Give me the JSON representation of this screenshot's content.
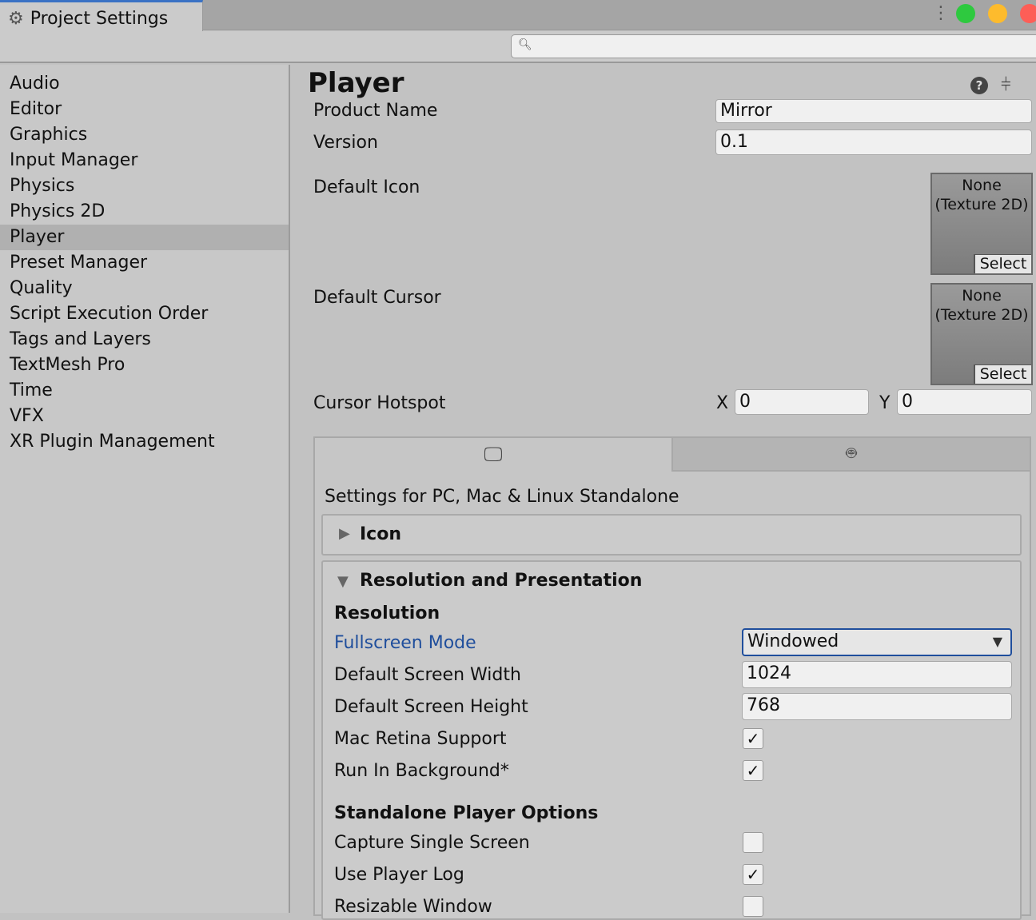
{
  "window": {
    "tab_title": "Project Settings",
    "search_placeholder": ""
  },
  "sidebar": {
    "items": [
      "Audio",
      "Editor",
      "Graphics",
      "Input Manager",
      "Physics",
      "Physics 2D",
      "Player",
      "Preset Manager",
      "Quality",
      "Script Execution Order",
      "Tags and Layers",
      "TextMesh Pro",
      "Time",
      "VFX",
      "XR Plugin Management"
    ],
    "selected": "Player"
  },
  "main": {
    "title": "Player",
    "product_name_label": "Product Name",
    "product_name": "Mirror",
    "version_label": "Version",
    "version": "0.1",
    "default_icon_label": "Default Icon",
    "default_cursor_label": "Default Cursor",
    "object_none": "None",
    "object_type": "(Texture 2D)",
    "select_label": "Select",
    "cursor_hotspot_label": "Cursor Hotspot",
    "x_label": "X",
    "x": "0",
    "y_label": "Y",
    "y": "0",
    "platform_tabs": [
      "desktop-icon",
      "android-icon"
    ],
    "settings_for": "Settings for PC, Mac & Linux Standalone",
    "icon_section": "Icon",
    "resolution_section": "Resolution and Presentation",
    "resolution_header": "Resolution",
    "fullscreen_mode_label": "Fullscreen Mode",
    "fullscreen_mode": "Windowed",
    "width_label": "Default Screen Width",
    "width": "1024",
    "height_label": "Default Screen Height",
    "height": "768",
    "retina_label": "Mac Retina Support",
    "retina": true,
    "run_bg_label": "Run In Background*",
    "run_bg": true,
    "standalone_header": "Standalone Player Options",
    "capture_label": "Capture Single Screen",
    "capture": false,
    "player_log_label": "Use Player Log",
    "player_log": true,
    "resizable_label": "Resizable Window",
    "resizable": false
  },
  "colors": {
    "accent_label": "#1f4e9c",
    "mac_green": "#2ec93f",
    "mac_yellow": "#fdbb2d",
    "mac_red": "#fd5e57"
  }
}
